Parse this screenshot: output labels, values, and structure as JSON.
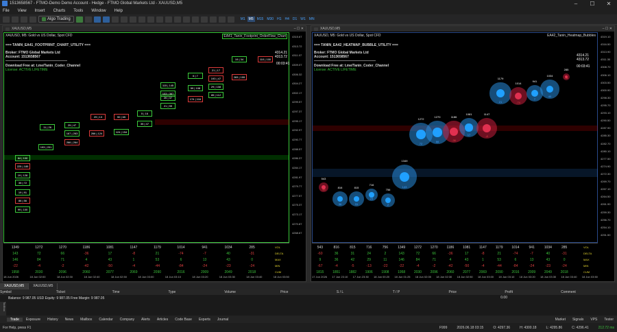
{
  "title": "1513658567 - FTMO-Demo Demo Account - Hedge - FTMO Global Markets Ltd - XAUUSD,M5",
  "menu": [
    "File",
    "View",
    "Insert",
    "Charts",
    "Tools",
    "Window",
    "Help"
  ],
  "toolbar": {
    "algo": "Algo Trading",
    "timeframes": [
      "M1",
      "M5",
      "M15",
      "M30",
      "H1",
      "H4",
      "D1",
      "W1",
      "MN"
    ],
    "active_tf": "M5"
  },
  "left": {
    "tab": "XAUUSD,M5",
    "header": "XAUUSD, M5:  Gold vs US Dollar, Spot CFD",
    "indicator": "EA41_Tanin_Footprint_OrderFlow_Chart",
    "subtitle": "=== TANIN_EA41_FOOTPRINT_CHART_UTILITY ===",
    "broker": "Broker: FTMO Global Markets Ltd",
    "account": "Account: 1513658567",
    "download": "Download Free at: t.me/Tanin_Coder_Channel",
    "license": "License: ACTIVE LIFETIME",
    "price": "4314.21",
    "price2": "4313.72",
    "timer": "00:03:41",
    "prices": [
      "4315.67",
      "4313.72",
      "4311.07",
      "4309.07",
      "4306.32",
      "4304.27",
      "4302.17",
      "4299.57",
      "4297.37",
      "4295.17",
      "4292.97",
      "4290.77",
      "4288.57",
      "4286.37",
      "4284.17",
      "4281.97",
      "4279.77",
      "4277.57",
      "4275.37",
      "4273.17",
      "4270.87",
      "4268.67"
    ],
    "vol": [
      "1349",
      "1272",
      "1270",
      "1186",
      "1081",
      "1147",
      "1179",
      "1014",
      "941",
      "1034",
      "285"
    ],
    "delta": [
      "143",
      "72",
      "66",
      "-36",
      "17",
      "-8",
      "21",
      "-74",
      "-7",
      "40",
      "-31"
    ],
    "max": [
      "146",
      "84",
      "71",
      "4",
      "43",
      "1",
      "53",
      "6",
      "13",
      "43",
      "0"
    ],
    "min": [
      "-22",
      "-4",
      "-2",
      "-42",
      "-50",
      "-4",
      "-44",
      "-84",
      "-24",
      "-23",
      "-24"
    ],
    "cum": [
      "1958",
      "2030",
      "2096",
      "2060",
      "2077",
      "2069",
      "2090",
      "2016",
      "2009",
      "2049",
      "2018"
    ],
    "rowlabels": [
      "VOL",
      "DELTA",
      "MAX",
      "MIN",
      "CUM"
    ],
    "times": [
      "18 Jun 2026",
      "18 Jun 02:00",
      "18 Jun 02:30",
      "18 Jun 02:40",
      "18 Jun 02:50",
      "18 Jun 03:00",
      "18 Jun 03:10",
      "18 Jun 03:20",
      "18 Jun 03:30",
      "18 Jun 03:40",
      "18 Jun 03:50"
    ],
    "boxes": [
      [
        "84",
        "100"
      ],
      [
        "225",
        "185"
      ],
      [
        "19",
        "128"
      ],
      [
        "35",
        "72"
      ],
      [
        "19",
        "91"
      ],
      [
        "86",
        "56"
      ],
      [
        "99",
        "100"
      ],
      [
        "11",
        "26"
      ],
      [
        "193",
        "201"
      ],
      [
        "25",
        "47"
      ],
      [
        "167",
        "263"
      ],
      [
        "266",
        "264"
      ],
      [
        "29",
        "13"
      ],
      [
        "266",
        "124"
      ],
      [
        "90",
        "65"
      ],
      [
        "124",
        "154"
      ],
      [
        "5",
        "16"
      ],
      [
        "35",
        "47"
      ],
      [
        "115",
        "145"
      ],
      [
        "26",
        "37"
      ],
      [
        "21",
        "99"
      ],
      [
        "103",
        "367"
      ],
      [
        "6",
        "7"
      ],
      [
        "59",
        "108"
      ],
      [
        "174",
        "116"
      ],
      [
        "21",
        "17"
      ],
      [
        "193",
        "47"
      ],
      [
        "29",
        "108"
      ],
      [
        "85",
        "112"
      ],
      [
        "19",
        "34"
      ],
      [
        "283",
        "155"
      ],
      [
        "110",
        "100"
      ]
    ]
  },
  "right": {
    "tab": "XAUUSD,M5",
    "header": "XAUUSD, M5:  Gold vs US Dollar, Spot CFD",
    "indicator": "EA42_Tanin_Heatmap_Bubbles",
    "subtitle": "=== TANIN_EA42_HEATMAP_BUBBLE_UTILITY ===",
    "broker": "Broker: FTMO Global Markets Ltd",
    "account": "Account: 1513658567",
    "download": "Download Free at: t.me/Tanin_Coder_Channel",
    "license": "License: ACTIVE LIFETIME",
    "price": "4314.21",
    "price2": "4313.72",
    "timer": "00:03:41",
    "prices": [
      "4319.10",
      "4316.50",
      "4313.90",
      "4311.30",
      "4308.70",
      "4306.10",
      "4303.50",
      "4300.90",
      "4298.30",
      "4295.70",
      "4293.10",
      "4290.50",
      "4287.90",
      "4285.30",
      "4282.70",
      "4280.10",
      "4277.50",
      "4274.90",
      "4272.30",
      "4269.70",
      "4267.10",
      "4264.50",
      "4261.90",
      "4259.30",
      "4256.70",
      "4254.10",
      "4251.50"
    ],
    "bubbles": [
      [
        "543",
        "-60"
      ],
      [
        "816",
        "36"
      ],
      [
        "815",
        "31"
      ],
      [
        "716",
        "24"
      ],
      [
        "756",
        "2"
      ],
      [
        "1349",
        "143"
      ],
      [
        "1272",
        "72"
      ],
      [
        "1270",
        "66"
      ],
      [
        "1186",
        "-36"
      ],
      [
        "1081",
        "17"
      ],
      [
        "1147",
        "-8"
      ],
      [
        "1179",
        "21"
      ],
      [
        "1014",
        "-74"
      ],
      [
        "941",
        "7"
      ],
      [
        "1034",
        "40"
      ],
      [
        "285",
        "-31"
      ]
    ],
    "vol": [
      "543",
      "816",
      "815",
      "716",
      "756",
      "1349",
      "1272",
      "1270",
      "1186",
      "1081",
      "1147",
      "1179",
      "1014",
      "941",
      "1034",
      "285"
    ],
    "delta": [
      "-60",
      "36",
      "31",
      "24",
      "2",
      "143",
      "72",
      "66",
      "-36",
      "17",
      "-8",
      "21",
      "-74",
      "-7",
      "40",
      "-31"
    ],
    "max": [
      "9",
      "36",
      "42",
      "29",
      "11",
      "146",
      "84",
      "71",
      "4",
      "43",
      "1",
      "53",
      "6",
      "13",
      "43",
      "0"
    ],
    "min": [
      "-67",
      "-4",
      "-5",
      "-13",
      "-22",
      "-22",
      "-4",
      "-2",
      "-42",
      "-50",
      "-4",
      "-44",
      "-84",
      "-24",
      "-23",
      "-24"
    ],
    "cum": [
      "1815",
      "1851",
      "1882",
      "1906",
      "1908",
      "1958",
      "2030",
      "2096",
      "2060",
      "2077",
      "2069",
      "2090",
      "2016",
      "2009",
      "2049",
      "2018"
    ],
    "rowlabels": [
      "VOL",
      "DELTA",
      "MAX",
      "MIN",
      "CUM"
    ],
    "times": [
      "17 Jun 2026",
      "17 Jun 23:10",
      "17 Jun 23:30",
      "18 Jun 00:20",
      "18 Jun 01:25",
      "18 Jun 02:05",
      "18 Jun 02:30",
      "18 Jun 02:50",
      "18 Jun 03:00",
      "18 Jun 03:10",
      "18 Jun 03:20",
      "18 Jun 03:30",
      "18 Jun 03:40",
      "18 Jun 03:50"
    ]
  },
  "wintabs": [
    "XAUUSD,M5",
    "XAUUSD,M5"
  ],
  "terminal": {
    "headers": [
      "Symbol",
      "Ticket",
      "Time",
      "Type",
      "Volume",
      "Price",
      "S / L",
      "T / P",
      "Price",
      "Profit",
      "Comment"
    ],
    "balance": "Balance: 9 987.05 USD  Equity: 9 987.05  Free Margin: 9 987.05",
    "profit": "0.00"
  },
  "ttabs": [
    "Trade",
    "Exposure",
    "History",
    "News",
    "Mailbox",
    "Calendar",
    "Company",
    "Alerts",
    "Articles",
    "Code Base",
    "Experts",
    "Journal"
  ],
  "ttabs_right": [
    "Market",
    "Signals",
    "VPS",
    "Tester"
  ],
  "status": {
    "help": "For Help, press F1",
    "profile": "F999",
    "dt": "2026.06.18 03:15",
    "o": "O: 4297.36",
    "h": "H: 4300.18",
    "l": "L: 4295.86",
    "c": "C: 4296.41",
    "ping": "212.72 ms"
  },
  "toolbox": "Toolbox"
}
